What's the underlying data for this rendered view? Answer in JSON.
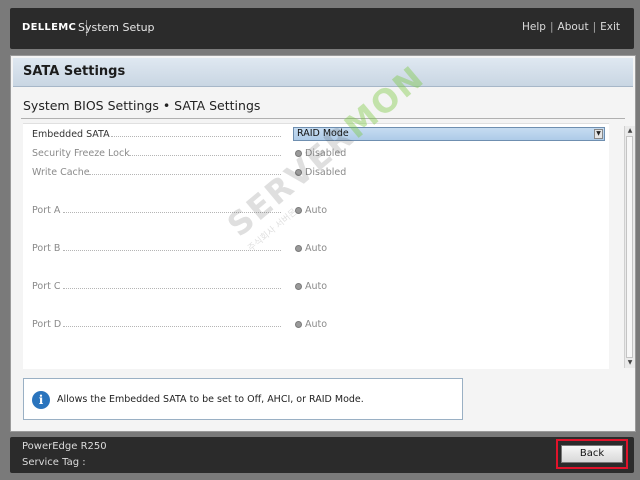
{
  "header": {
    "brand": "DELLEMC",
    "title": "System Setup",
    "links": {
      "help": "Help",
      "about": "About",
      "exit": "Exit",
      "separator": "|"
    }
  },
  "page": {
    "title": "SATA Settings",
    "breadcrumb": "System BIOS Settings • SATA Settings"
  },
  "settings": [
    {
      "label": "Embedded SATA",
      "type": "select",
      "value": "RAID Mode",
      "enabled": true
    },
    {
      "label": "Security Freeze Lock",
      "type": "radio",
      "value": "Disabled",
      "enabled": false
    },
    {
      "label": "Write Cache",
      "type": "radio",
      "value": "Disabled",
      "enabled": false
    },
    {
      "label": "Port A",
      "type": "radio",
      "value": "Auto",
      "enabled": false
    },
    {
      "label": "Port B",
      "type": "radio",
      "value": "Auto",
      "enabled": false
    },
    {
      "label": "Port C",
      "type": "radio",
      "value": "Auto",
      "enabled": false
    },
    {
      "label": "Port D",
      "type": "radio",
      "value": "Auto",
      "enabled": false
    }
  ],
  "help": {
    "icon": "info-icon",
    "text": "Allows the Embedded SATA to be set to Off, AHCI, or RAID Mode."
  },
  "footer": {
    "model": "PowerEdge R250",
    "service_tag": "Service Tag :",
    "back_label": "Back"
  },
  "watermark": {
    "text_main": "SERVER",
    "text_accent": "MON",
    "subtext": "주식회사 서버몬"
  },
  "colors": {
    "accent": "#2a74bd",
    "highlight_border": "#e0132b",
    "select_fill": "#aecbe8"
  }
}
